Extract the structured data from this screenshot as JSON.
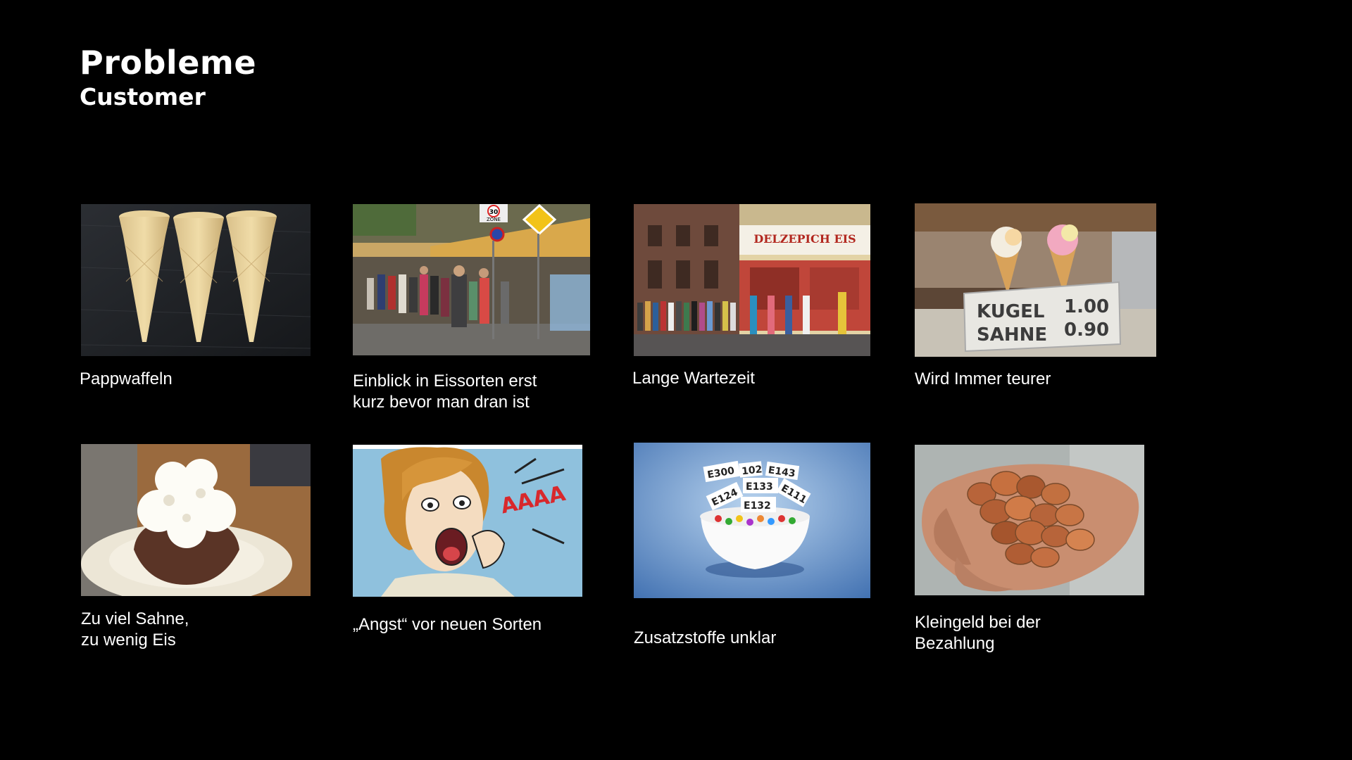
{
  "slide": {
    "title": "Probleme",
    "subtitle": "Customer"
  },
  "cards": [
    {
      "caption": "Pappwaffeln",
      "image": "empty-ice-cream-cones"
    },
    {
      "caption": "Einblick in Eissorten erst\nkurz bevor man dran ist",
      "image": "queue-in-front-of-ice-cream-shop"
    },
    {
      "caption": "Lange Wartezeit",
      "image": "long-line-at-ice-cream-parlor"
    },
    {
      "caption": "Wird Immer teurer",
      "image": "ice-cream-price-sign"
    },
    {
      "caption": "Zu viel Sahne,\nzu wenig Eis",
      "image": "ice-cream-with-whipped-cream"
    },
    {
      "caption": "„Angst“ vor neuen Sorten",
      "image": "pop-art-screaming-woman"
    },
    {
      "caption": "Zusatzstoffe unklar",
      "image": "bowl-of-candy-with-e-numbers"
    },
    {
      "caption": "Kleingeld bei der\nBezahlung",
      "image": "hand-full-of-coins"
    }
  ],
  "image_text": {
    "zone_sign": "ZONE",
    "zone_number": "30",
    "shop_sign": "DELZEPICH EIS",
    "price_row1_label": "KUGEL",
    "price_row1_value": "1.00",
    "price_row2_label": "SAHNE",
    "price_row2_value": "0.90",
    "comic_scream": "AAAA",
    "e_numbers": [
      "E300",
      "102",
      "E143",
      "E133",
      "E124",
      "E111",
      "E132"
    ]
  }
}
